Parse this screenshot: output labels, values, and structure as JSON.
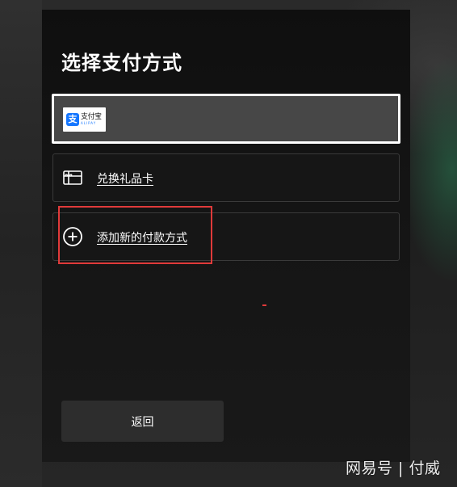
{
  "dialog": {
    "title": "选择支付方式",
    "payment_options": [
      {
        "type": "alipay",
        "selected": true,
        "logo": {
          "cn": "支付宝",
          "en": "ALIPAY",
          "mark": "支"
        },
        "icon": "alipay-logo"
      },
      {
        "type": "gift-card",
        "label": "兑换礼品卡",
        "icon": "gift-card-icon"
      },
      {
        "type": "add-new",
        "label": "添加新的付款方式",
        "icon": "plus-circle-icon",
        "highlighted": true
      }
    ],
    "back_label": "返回"
  },
  "watermark": "网易号 | 付威",
  "colors": {
    "dialog_bg": "#141414",
    "selected_bg": "#474747",
    "selected_border": "#ffffff",
    "option_border": "#3a3a3a",
    "highlight": "#e03a3a",
    "button_bg": "#2d2d2d",
    "alipay_blue": "#1677ff"
  }
}
